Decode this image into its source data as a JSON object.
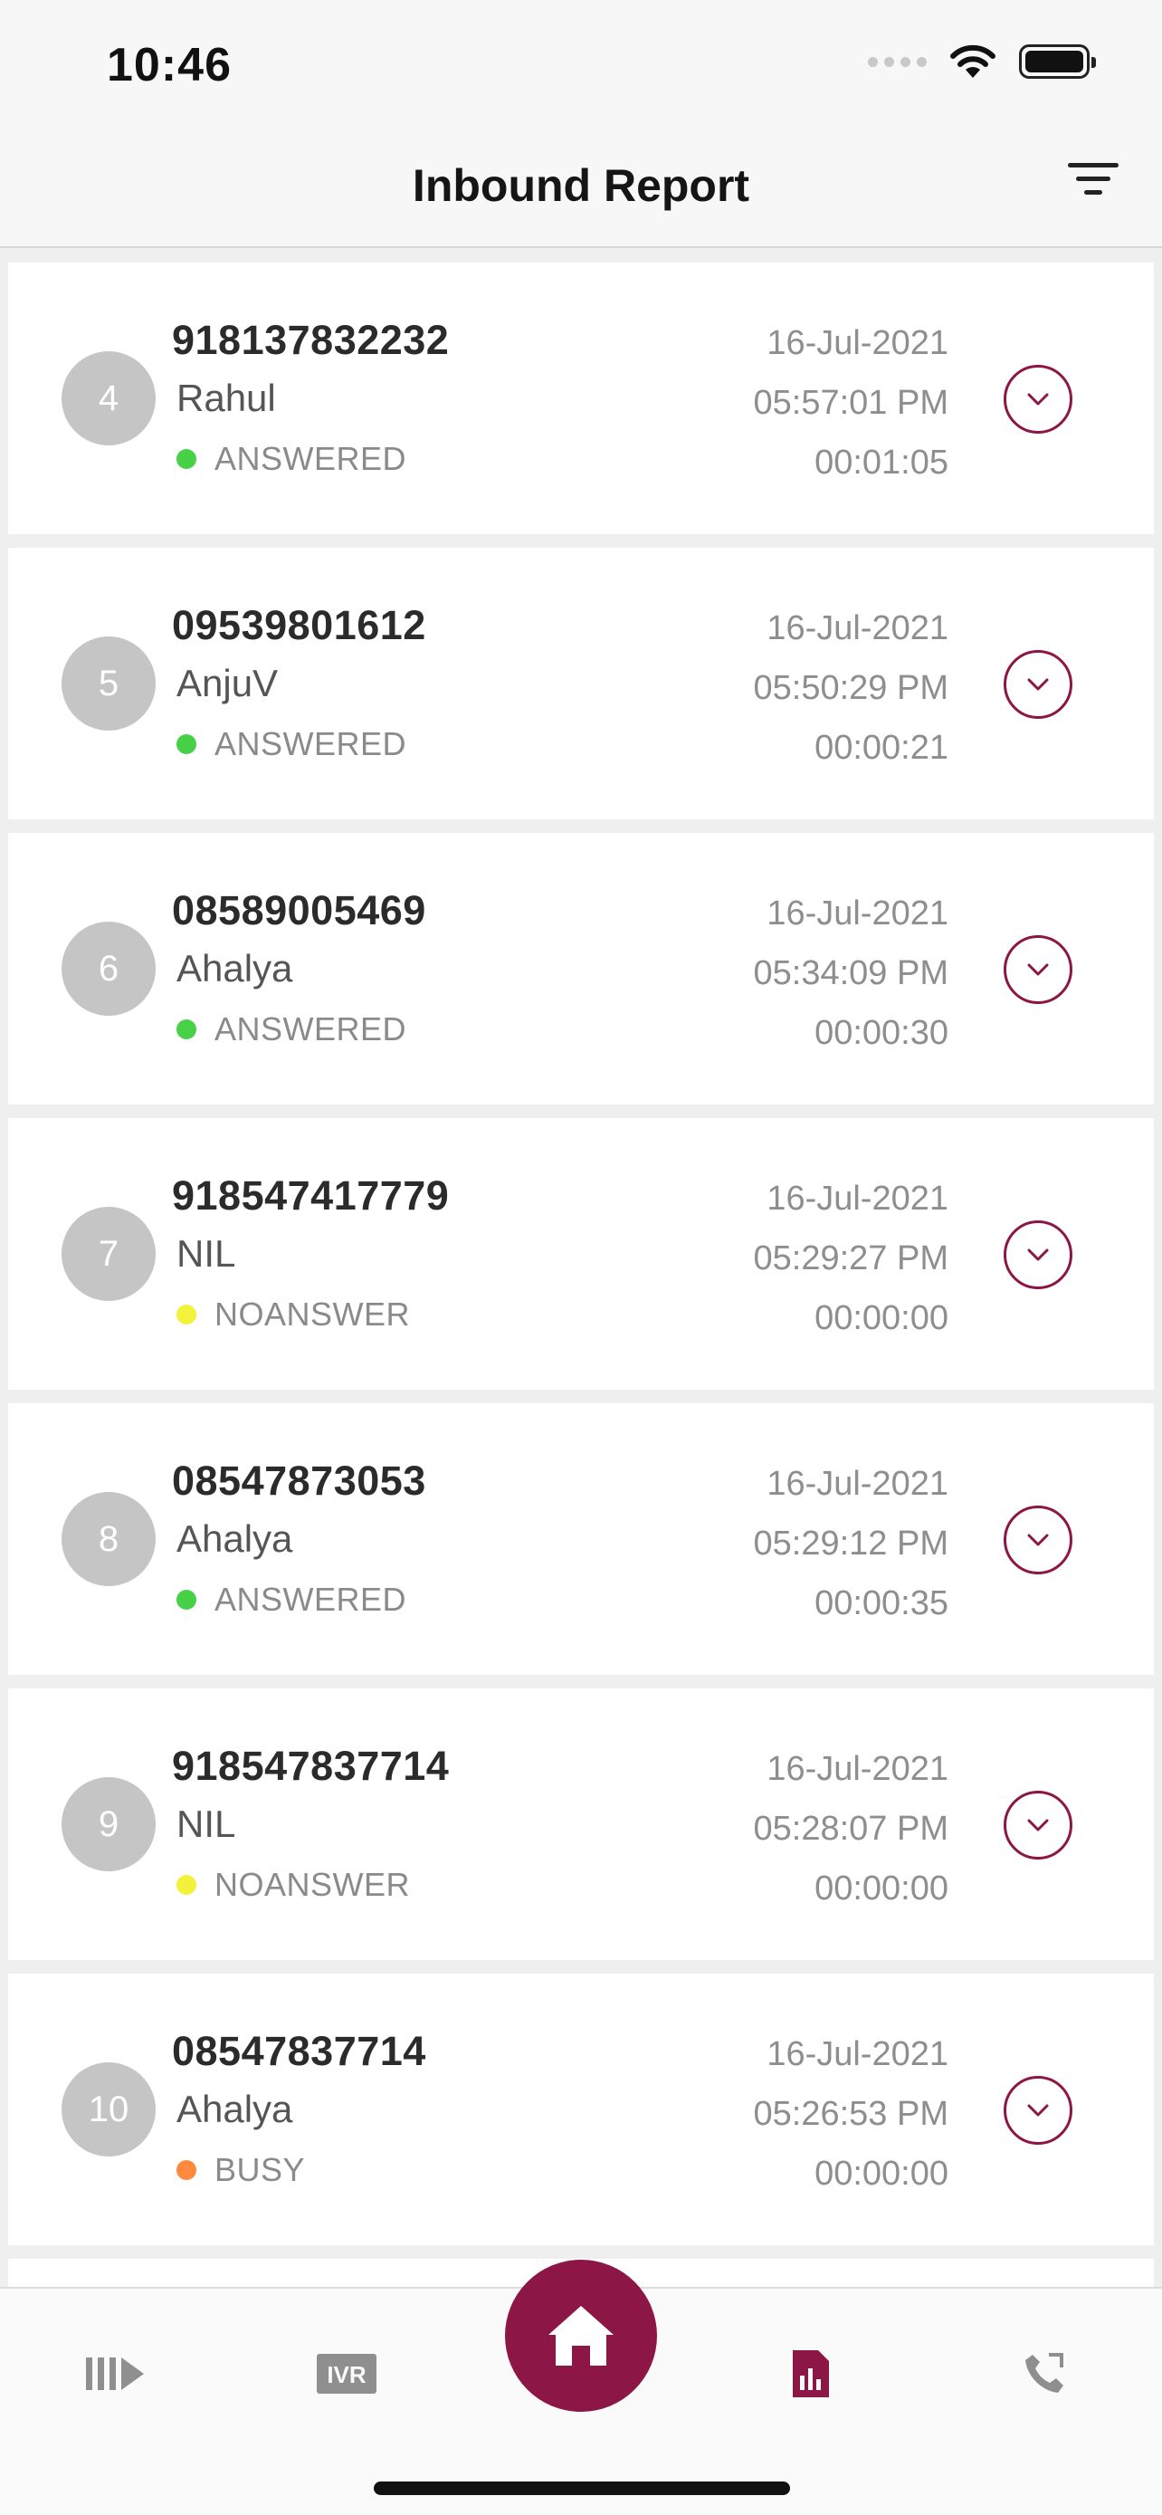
{
  "status_bar": {
    "time": "10:46"
  },
  "header": {
    "title": "Inbound Report"
  },
  "colors": {
    "accent": "#8c1646",
    "answered": "#47d147",
    "noanswer": "#f2f23a",
    "busy": "#ff8a3d"
  },
  "calls": [
    {
      "index": "4",
      "number": "918137832232",
      "agent": "Rahul",
      "status": "ANSWERED",
      "date": "16-Jul-2021",
      "time": "05:57:01 PM",
      "duration": "00:01:05"
    },
    {
      "index": "5",
      "number": "09539801612",
      "agent": "AnjuV",
      "status": "ANSWERED",
      "date": "16-Jul-2021",
      "time": "05:50:29 PM",
      "duration": "00:00:21"
    },
    {
      "index": "6",
      "number": "08589005469",
      "agent": "Ahalya",
      "status": "ANSWERED",
      "date": "16-Jul-2021",
      "time": "05:34:09 PM",
      "duration": "00:00:30"
    },
    {
      "index": "7",
      "number": "918547417779",
      "agent": "NIL",
      "status": "NOANSWER",
      "date": "16-Jul-2021",
      "time": "05:29:27 PM",
      "duration": "00:00:00"
    },
    {
      "index": "8",
      "number": "08547873053",
      "agent": "Ahalya",
      "status": "ANSWERED",
      "date": "16-Jul-2021",
      "time": "05:29:12 PM",
      "duration": "00:00:35"
    },
    {
      "index": "9",
      "number": "918547837714",
      "agent": "NIL",
      "status": "NOANSWER",
      "date": "16-Jul-2021",
      "time": "05:28:07 PM",
      "duration": "00:00:00"
    },
    {
      "index": "10",
      "number": "08547837714",
      "agent": "Ahalya",
      "status": "BUSY",
      "date": "16-Jul-2021",
      "time": "05:26:53 PM",
      "duration": "00:00:00"
    }
  ],
  "nav": {
    "items": [
      {
        "icon": "queue-play-icon"
      },
      {
        "icon": "ivr-icon",
        "label": "IVR"
      },
      {
        "icon": "home-icon"
      },
      {
        "icon": "report-icon"
      },
      {
        "icon": "call-log-icon"
      }
    ]
  }
}
